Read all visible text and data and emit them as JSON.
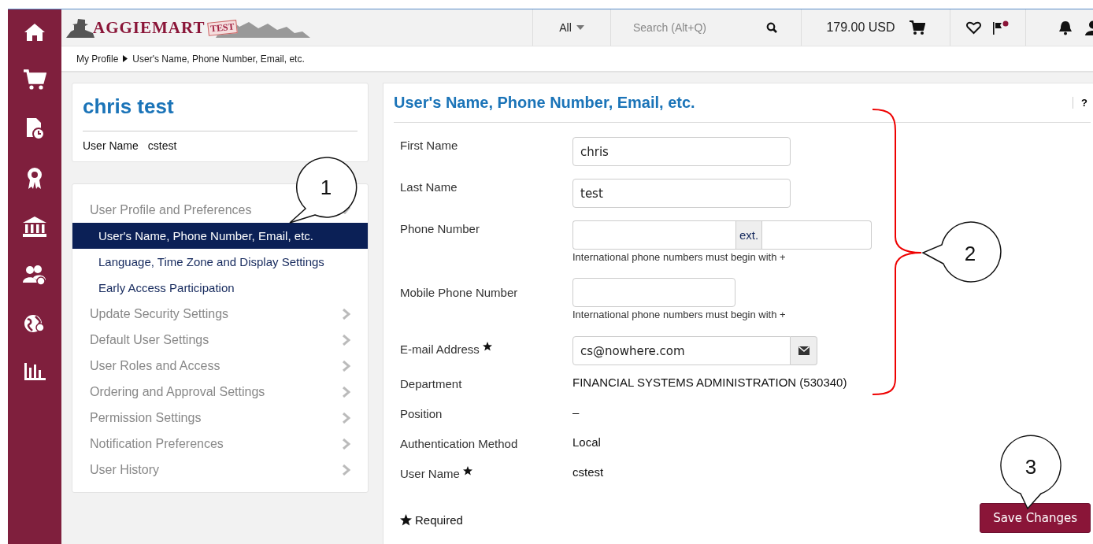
{
  "header": {
    "logo": {
      "name": "AGGIEMART",
      "badge": "TEST"
    },
    "search_scope": "All",
    "search": {
      "placeholder": "Search (Alt+Q)"
    },
    "cart_total": "179.00 USD",
    "flag_alert": true
  },
  "breadcrumb": [
    "My Profile",
    "User's Name, Phone Number, Email, etc."
  ],
  "profile_card": {
    "name": "chris test",
    "username_label": "User Name",
    "username": "cstest"
  },
  "nav": [
    {
      "label": "User Profile and Preferences",
      "expanded": true,
      "children": [
        {
          "label": "User's Name, Phone Number, Email, etc.",
          "selected": true
        },
        {
          "label": "Language, Time Zone and Display Settings",
          "selected": false
        },
        {
          "label": "Early Access Participation",
          "selected": false
        }
      ]
    },
    {
      "label": "Update Security Settings",
      "expanded": false
    },
    {
      "label": "Default User Settings",
      "expanded": false
    },
    {
      "label": "User Roles and Access",
      "expanded": false
    },
    {
      "label": "Ordering and Approval Settings",
      "expanded": false
    },
    {
      "label": "Permission Settings",
      "expanded": false
    },
    {
      "label": "Notification Preferences",
      "expanded": false
    },
    {
      "label": "User History",
      "expanded": false
    }
  ],
  "panel": {
    "title": "User's Name, Phone Number, Email, etc.",
    "help": "?",
    "fields": [
      {
        "kind": "text",
        "label": "First Name",
        "value": "chris",
        "required": false
      },
      {
        "kind": "text",
        "label": "Last Name",
        "value": "test",
        "required": false
      },
      {
        "kind": "phone",
        "label": "Phone Number",
        "ext_label": "ext.",
        "hint": "International phone numbers must begin with +",
        "required": false
      },
      {
        "kind": "short",
        "label": "Mobile Phone Number",
        "hint": "International phone numbers must begin with +",
        "required": false
      },
      {
        "kind": "email",
        "label": "E-mail Address",
        "value": "cs@nowhere.com",
        "required": true
      },
      {
        "kind": "static",
        "label": "Department",
        "value": "FINANCIAL SYSTEMS ADMINISTRATION (530340)",
        "required": false
      },
      {
        "kind": "static",
        "label": "Position",
        "value": "–",
        "required": false
      },
      {
        "kind": "static",
        "label": "Authentication Method",
        "value": "Local",
        "required": false
      },
      {
        "kind": "static",
        "label": "User Name",
        "value": "cstest",
        "required": true
      }
    ],
    "required_note": "Required",
    "save_button": "Save Changes"
  },
  "callouts": [
    "1",
    "2",
    "3"
  ]
}
